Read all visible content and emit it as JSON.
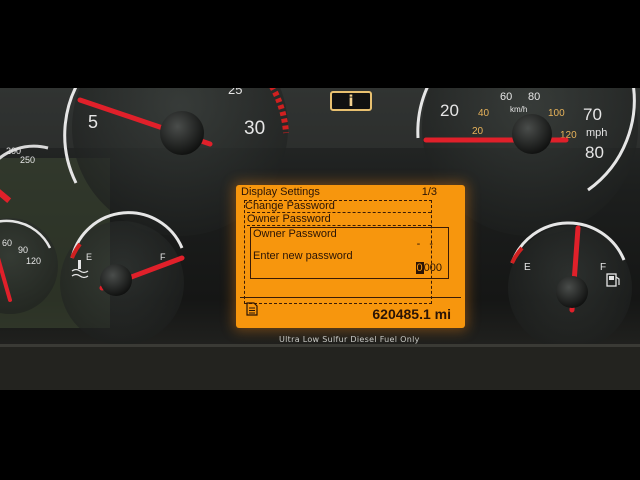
{
  "tachometer": {
    "labels": [
      "5",
      "25",
      "30"
    ]
  },
  "speedometer": {
    "outer_labels": [
      "20",
      "70",
      "80"
    ],
    "inner_labels": [
      "60",
      "80",
      "40",
      "20",
      "100",
      "120"
    ],
    "unit_kmh": "km/h",
    "unit_mph": "mph"
  },
  "left_gauge": {
    "labels": [
      "250",
      "200"
    ]
  },
  "oil_gauge": {
    "labels": [
      "60",
      "90",
      "120"
    ]
  },
  "temp_gauge": {
    "empty": "E",
    "full": "F"
  },
  "fuel_gauge": {
    "empty": "E",
    "full": "F"
  },
  "info_lamp": "i",
  "display": {
    "title": "Display Settings",
    "page": "1/3",
    "menu_item_1": "Change Password",
    "menu_item_2": "Owner Password",
    "dialog_title": "Owner Password",
    "dialog_value": "- -",
    "prompt": "Enter new password",
    "entry_cursor": "0",
    "entry_rest": "000",
    "odometer": "620485.1 mi"
  },
  "fuel_notice": "Ultra Low Sulfur Diesel Fuel Only",
  "colors": {
    "display_bg": "#f7960d",
    "needle": "#e0202a",
    "display_text": "#2a1406"
  }
}
